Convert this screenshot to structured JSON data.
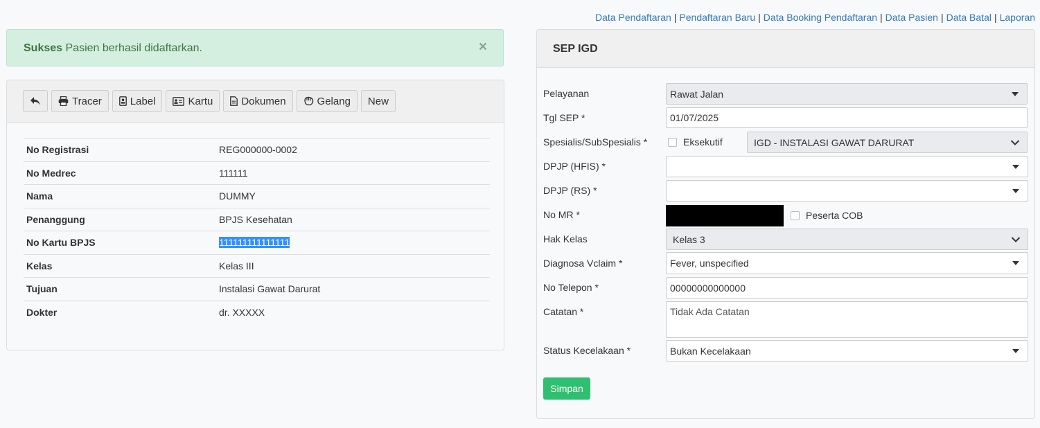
{
  "topnav": {
    "links": [
      "Data Pendaftaran",
      "Pendaftaran Baru",
      "Data Booking Pendaftaran",
      "Data Pasien",
      "Data Batal",
      "Laporan"
    ],
    "separator": "|"
  },
  "alert": {
    "strong": "Sukses",
    "text": " Pasien berhasil didaftarkan.",
    "close": "×"
  },
  "toolbar": {
    "back_icon": "undo-icon",
    "tracer": "Tracer",
    "label": "Label",
    "kartu": "Kartu",
    "dokumen": "Dokumen",
    "gelang": "Gelang",
    "new": "New"
  },
  "patient": {
    "rows": [
      {
        "label": "No Registrasi",
        "value": "REG000000-0002"
      },
      {
        "label": "No Medrec",
        "value": "111111"
      },
      {
        "label": "Nama",
        "value": "DUMMY"
      },
      {
        "label": "Penanggung",
        "value": "BPJS Kesehatan"
      },
      {
        "label": "No Kartu BPJS",
        "value": "111111111111111"
      },
      {
        "label": "Kelas",
        "value": "Kelas III"
      },
      {
        "label": "Tujuan",
        "value": "Instalasi Gawat Darurat"
      },
      {
        "label": "Dokter",
        "value": "dr. XXXXX"
      }
    ]
  },
  "sep": {
    "title": "SEP IGD",
    "pelayanan_label": "Pelayanan",
    "pelayanan_value": "Rawat Jalan",
    "tgl_label": "Tgl SEP *",
    "tgl_value": "01/07/2025",
    "spesialis_label": "Spesialis/SubSpesialis *",
    "eksekutif_label": "Eksekutif",
    "spesialis_value": "IGD - INSTALASI GAWAT DARURAT",
    "dpjp_hfis_label": "DPJP (HFIS) *",
    "dpjp_hfis_value": "",
    "dpjp_rs_label": "DPJP (RS) *",
    "dpjp_rs_value": "",
    "nomr_label": "No MR *",
    "cob_label": "Peserta COB",
    "hak_kelas_label": "Hak Kelas",
    "hak_kelas_value": "Kelas 3",
    "diagnosa_label": "Diagnosa Vclaim *",
    "diagnosa_value": "Fever, unspecified",
    "telepon_label": "No Telepon *",
    "telepon_value": "00000000000000",
    "catatan_label": "Catatan *",
    "catatan_value": "Tidak Ada Catatan",
    "status_label": "Status Kecelakaan *",
    "status_value": "Bukan Kecelakaan",
    "save": "Simpan"
  }
}
